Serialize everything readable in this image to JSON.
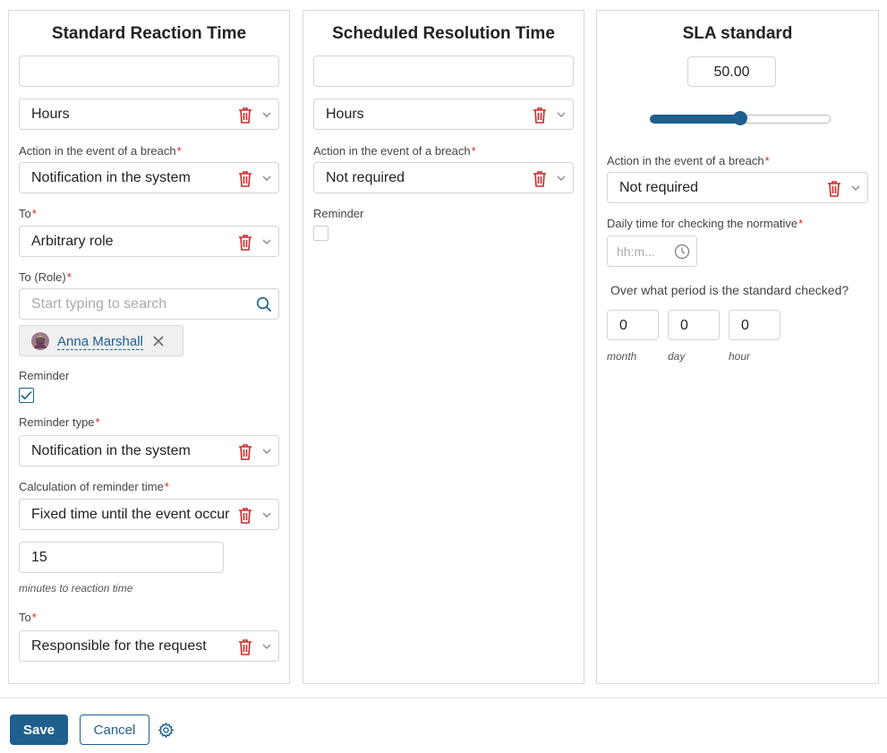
{
  "colors": {
    "accent": "#1e5f8e",
    "required": "#dd2222",
    "trash": "#cc2b2b",
    "border": "#d4d4d4"
  },
  "reaction": {
    "title": "Standard Reaction Time",
    "time_value": "",
    "unit": "Hours",
    "breach_label": "Action in the event of a breach",
    "breach_value": "Notification in the system",
    "to_label": "To",
    "to_value": "Arbitrary role",
    "to_role_label": "To (Role)",
    "search_placeholder": "Start typing to search",
    "selected_user": "Anna Marshall",
    "reminder_label": "Reminder",
    "reminder_checked": true,
    "reminder_type_label": "Reminder type",
    "reminder_type_value": "Notification in the system",
    "calc_label": "Calculation of reminder time",
    "calc_value": "Fixed time until the event occurs",
    "minutes_value": "15",
    "minutes_hint": "minutes to reaction time",
    "to2_label": "To",
    "to2_value": "Responsible for the request"
  },
  "resolution": {
    "title": "Scheduled Resolution Time",
    "time_value": "",
    "unit": "Hours",
    "breach_label": "Action in the event of a breach",
    "breach_value": "Not required",
    "reminder_label": "Reminder",
    "reminder_checked": false
  },
  "sla": {
    "title": "SLA standard",
    "value": "50.00",
    "slider_fraction": 0.5,
    "breach_label": "Action in the event of a breach",
    "breach_value": "Not required",
    "daily_label": "Daily time for checking the normative",
    "time_placeholder": "hh:m...",
    "period_label": "Over what period is the standard checked?",
    "month_value": "0",
    "day_value": "0",
    "hour_value": "0",
    "month_label": "month",
    "day_label": "day",
    "hour_label": "hour"
  },
  "footer": {
    "save_label": "Save",
    "cancel_label": "Cancel"
  }
}
